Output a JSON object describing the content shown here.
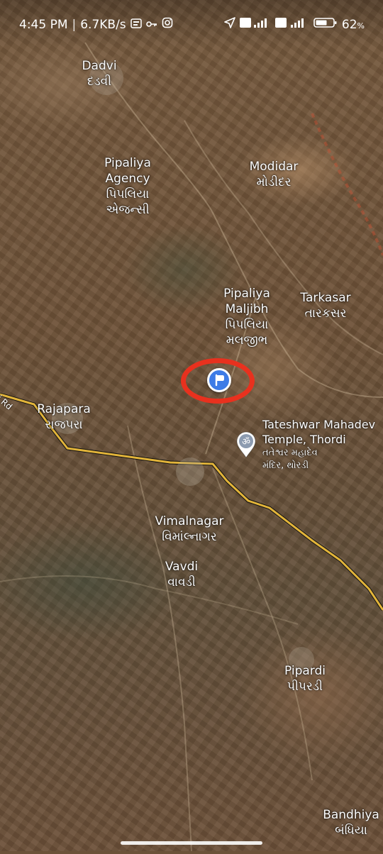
{
  "status_bar": {
    "time": "4:45 PM",
    "speed": "6.7KB/s",
    "battery": "62"
  },
  "map": {
    "road_label": "aji Rd",
    "places": [
      {
        "id": "dadvi",
        "name": "Dadvi",
        "local": "દડવી"
      },
      {
        "id": "pipaliya-agency",
        "name": "Pipaliya\nAgency",
        "local": "પિપલિયા\nએજન્સી"
      },
      {
        "id": "modidar",
        "name": "Modidar",
        "local": "મોડીદર"
      },
      {
        "id": "pipaliya-maljibh",
        "name": "Pipaliya\nMaljibh",
        "local": "પિપલિયા\nમલજીભ"
      },
      {
        "id": "tarkasar",
        "name": "Tarkasar",
        "local": "તારકસર"
      },
      {
        "id": "rajapara",
        "name": "Rajapara",
        "local": "રાજપરા"
      },
      {
        "id": "vimalnagar",
        "name": "Vimalnagar",
        "local": "વિમાંલ્નાગર"
      },
      {
        "id": "vavdi",
        "name": "Vavdi",
        "local": "વાવડી"
      },
      {
        "id": "pipardi",
        "name": "Pipardi",
        "local": "પીપરડી"
      },
      {
        "id": "bandhiya",
        "name": "Bandhiya",
        "local": "બંધિયા"
      }
    ],
    "poi": {
      "name": "Tateshwar Mahadev\nTemple, Thordi",
      "local": "તતેશ્વર મહાદેવ\nમંદિર, થોરડી",
      "icon": "om-temple-icon"
    },
    "dropped_pin": {
      "icon": "flag-pin-icon",
      "color": "#3d7be6"
    },
    "highlight": {
      "color": "#e8311e"
    }
  }
}
